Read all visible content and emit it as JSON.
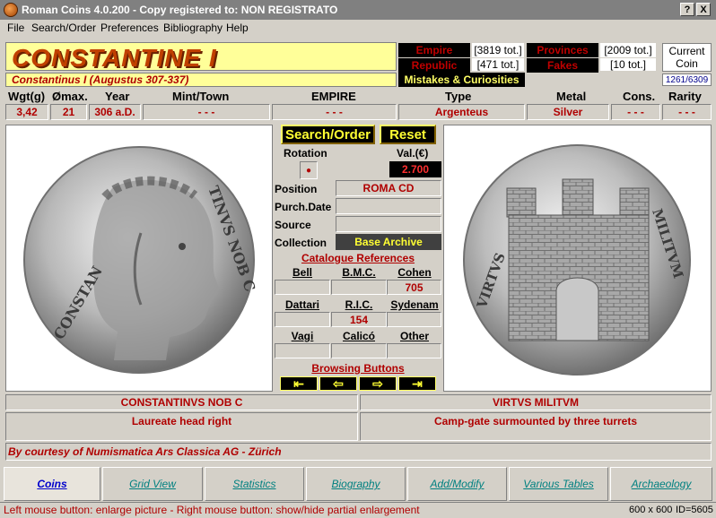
{
  "window": {
    "title": "Roman Coins 4.0.200 - Copy registered to:  NON REGISTRATO",
    "help_button": "?",
    "close_button": "X"
  },
  "menu": [
    "File",
    "Search/Order",
    "Preferences",
    "Bibliography",
    "Help"
  ],
  "header": {
    "emperor_name": "CONSTANTINE I",
    "reign": "Constantinus I (Augustus 307-337)",
    "nav": {
      "empire": "Empire",
      "empire_count": "[3819 tot.]",
      "provinces": "Provinces",
      "provinces_count": "[2009 tot.]",
      "republic": "Republic",
      "republic_count": "[471 tot.]",
      "fakes": "Fakes",
      "fakes_count": "[10 tot.]",
      "mistakes": "Mistakes & Curiosities"
    },
    "current_coin_label": "Current Coin",
    "current_coin_value": "1261/6309"
  },
  "fields": {
    "headers": {
      "weight": "Wgt(g)",
      "diameter": "Ømax.",
      "year": "Year",
      "mint": "Mint/Town",
      "empire": "EMPIRE",
      "type": "Type",
      "metal": "Metal",
      "cons": "Cons.",
      "rarity": "Rarity"
    },
    "values": {
      "weight": "3,42",
      "diameter": "21",
      "year": "306 a.D.",
      "mint": "- - -",
      "empire": "- - -",
      "type": "Argenteus",
      "metal": "Silver",
      "cons": "- - -",
      "rarity": "- - -"
    }
  },
  "center": {
    "search_button": "Search/Order",
    "reset_button": "Reset",
    "rotation_label": "Rotation",
    "rotation_value": "●",
    "value_label": "Val.(€)",
    "value": "2.700",
    "position_label": "Position",
    "position_value": "ROMA CD",
    "purch_label": "Purch.Date",
    "purch_value": "",
    "source_label": "Source",
    "source_value": "",
    "collection_label": "Collection",
    "collection_value": "Base Archive",
    "catalogue_title": "Catalogue References",
    "refs": {
      "bell": "Bell",
      "bmc": "B.M.C.",
      "cohen": "Cohen",
      "bell_val": "",
      "bmc_val": "",
      "cohen_val": "705",
      "dattari": "Dattari",
      "ric": "R.I.C.",
      "sydenam": "Sydenam",
      "dattari_val": "",
      "ric_val": "154",
      "sydenam_val": "",
      "vagi": "Vagi",
      "calico": "Calicó",
      "other": "Other",
      "vagi_val": "",
      "calico_val": "",
      "other_val": ""
    },
    "browsing_title": "Browsing Buttons",
    "arrows": [
      "⇤",
      "⇦",
      "⇨",
      "⇥"
    ]
  },
  "legends": {
    "obverse_legend": "CONSTANTINVS NOB C",
    "reverse_legend": "VIRTVS MILITVM",
    "obverse_desc": "Laureate head right",
    "reverse_desc": "Camp-gate surmounted by three turrets",
    "courtesy": "By courtesy of Numismatica Ars Classica AG - Zürich"
  },
  "tabs": [
    "Coins",
    "Grid View",
    "Statistics",
    "Biography",
    "Add/Modify",
    "Various Tables",
    "Archaeology"
  ],
  "status": {
    "hint": "Left mouse button: enlarge picture - Right mouse button: show/hide partial enlargement",
    "size": "600 x 600",
    "id": "ID=5605"
  },
  "colors": {
    "accent_red": "#b00000",
    "name_yellow": "#ffff99",
    "button_black": "#000000",
    "button_text_yellow": "#ffff33"
  }
}
